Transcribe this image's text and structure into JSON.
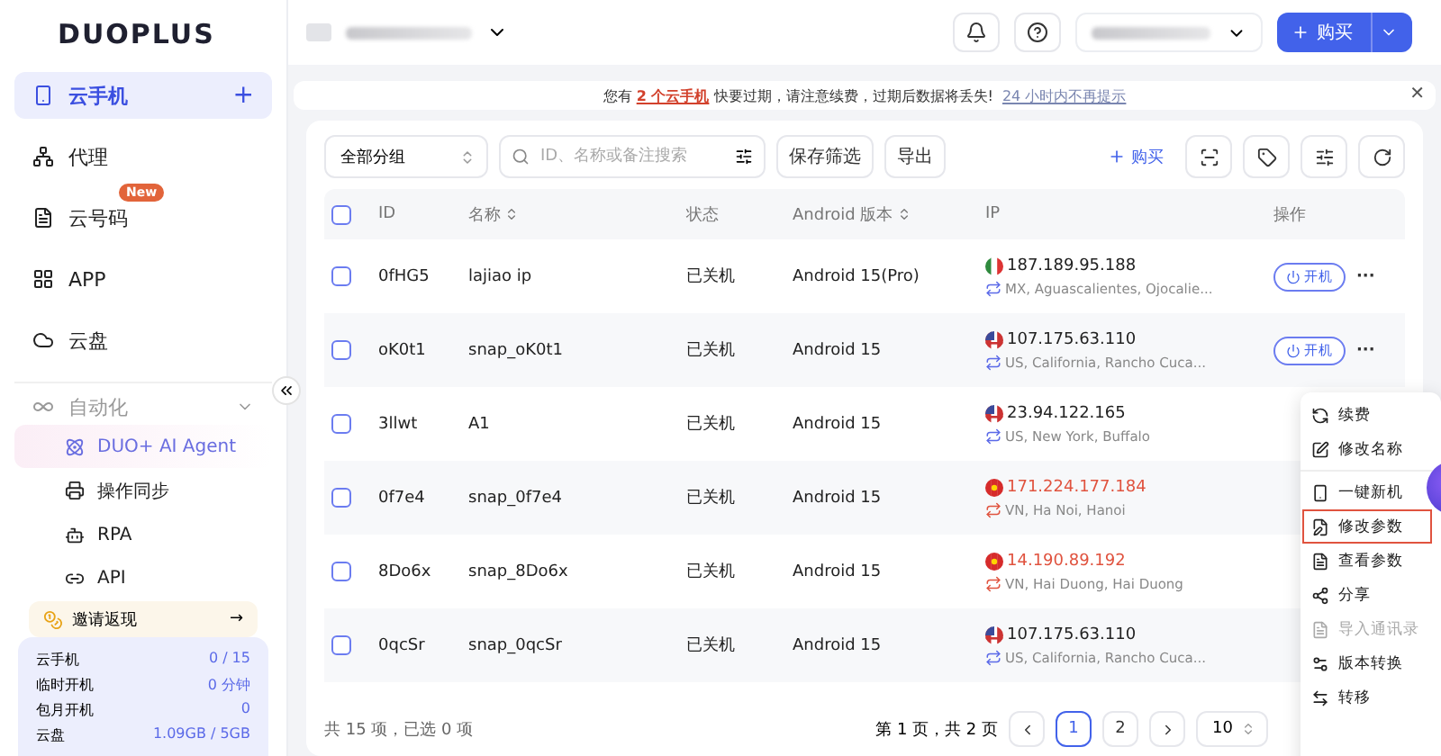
{
  "logo": "DUOPLUS",
  "sidebar": {
    "items": [
      {
        "label": "云手机",
        "selected": true,
        "add": "+"
      },
      {
        "label": "代理",
        "selected": false
      },
      {
        "label": "云号码",
        "selected": false,
        "badge": "New"
      },
      {
        "label": "APP",
        "selected": false
      },
      {
        "label": "云盘",
        "selected": false
      }
    ],
    "group": {
      "label": "自动化",
      "expanded": true,
      "children": [
        {
          "label": "DUO+ AI Agent",
          "selected": true
        },
        {
          "label": "操作同步",
          "selected": false
        },
        {
          "label": "RPA",
          "selected": false
        },
        {
          "label": "API",
          "selected": false
        }
      ]
    },
    "invite": {
      "label": "邀请返现",
      "arrow": "→"
    },
    "usage": [
      {
        "name": "云手机",
        "value": "0 / 15"
      },
      {
        "name": "临时开机",
        "value": "0 分钟"
      },
      {
        "name": "包月开机",
        "value": "0"
      },
      {
        "name": "云盘",
        "value": "1.09GB / 5GB"
      }
    ]
  },
  "header": {
    "buy_label": "购买"
  },
  "notice": {
    "before": "您有",
    "link": "2 个云手机",
    "after": "快要过期，请注意续费，过期后数据将丢失!",
    "dismiss": "24 小时内不再提示",
    "close": "✕"
  },
  "toolbar": {
    "group_select": "全部分组",
    "search_placeholder": "ID、名称或备注搜索",
    "save_filter": "保存筛选",
    "export": "导出",
    "buy": "购买"
  },
  "table": {
    "all_checked": false,
    "columns": [
      "ID",
      "名称",
      "状态",
      "Android 版本",
      "IP",
      "操作"
    ],
    "rows": [
      {
        "id": "0fHG5",
        "name": "lajiao ip",
        "status": "已关机",
        "android": "Android 15(Pro)",
        "kind": "mexico",
        "ip": "187.189.95.188",
        "location": "MX, Aguascalientes, Ojocalie...",
        "warning": false,
        "checked": false,
        "action": "开机",
        "more": "···"
      },
      {
        "id": "oK0t1",
        "name": "snap_oK0t1",
        "status": "已关机",
        "android": "Android 15",
        "kind": "usa",
        "ip": "107.175.63.110",
        "location": "US, California, Rancho Cuca...",
        "warning": false,
        "checked": false,
        "action": "开机",
        "more": "···"
      },
      {
        "id": "3llwt",
        "name": "A1",
        "status": "已关机",
        "android": "Android 15",
        "kind": "usa",
        "ip": "23.94.122.165",
        "location": "US, New York, Buffalo",
        "warning": false,
        "checked": false
      },
      {
        "id": "0f7e4",
        "name": "snap_0f7e4",
        "status": "已关机",
        "android": "Android 15",
        "kind": "vietnam",
        "ip": "171.224.177.184",
        "location": "VN, Ha Noi, Hanoi",
        "warning": true,
        "checked": false
      },
      {
        "id": "8Do6x",
        "name": "snap_8Do6x",
        "status": "已关机",
        "android": "Android 15",
        "kind": "vietnam",
        "ip": "14.190.89.192",
        "location": "VN, Hai Duong, Hai Duong",
        "warning": true,
        "checked": false
      },
      {
        "id": "0qcSr",
        "name": "snap_0qcSr",
        "status": "已关机",
        "android": "Android 15",
        "kind": "usa",
        "ip": "107.175.63.110",
        "location": "US, California, Rancho Cuca...",
        "warning": false,
        "checked": false
      }
    ]
  },
  "footer": {
    "summary": "共 15 项，已选 0 项",
    "page_info": "第 1 页，共 2 页",
    "pages": [
      {
        "label": "1",
        "selected": true
      },
      {
        "label": "2",
        "selected": false
      }
    ],
    "page_size": "10"
  },
  "menu": {
    "items": [
      {
        "label": "续费",
        "disabled": false,
        "selected": false
      },
      {
        "label": "修改名称",
        "disabled": false,
        "selected": false
      },
      {
        "label": "一键新机",
        "disabled": false,
        "selected": false
      },
      {
        "label": "修改参数",
        "disabled": false,
        "selected": true
      },
      {
        "label": "查看参数",
        "disabled": false,
        "selected": false
      },
      {
        "label": "分享",
        "disabled": false,
        "selected": false
      },
      {
        "label": "导入通讯录",
        "disabled": true,
        "selected": false
      },
      {
        "label": "版本转换",
        "disabled": false,
        "selected": false
      },
      {
        "label": "转移",
        "disabled": false,
        "selected": false
      }
    ]
  }
}
